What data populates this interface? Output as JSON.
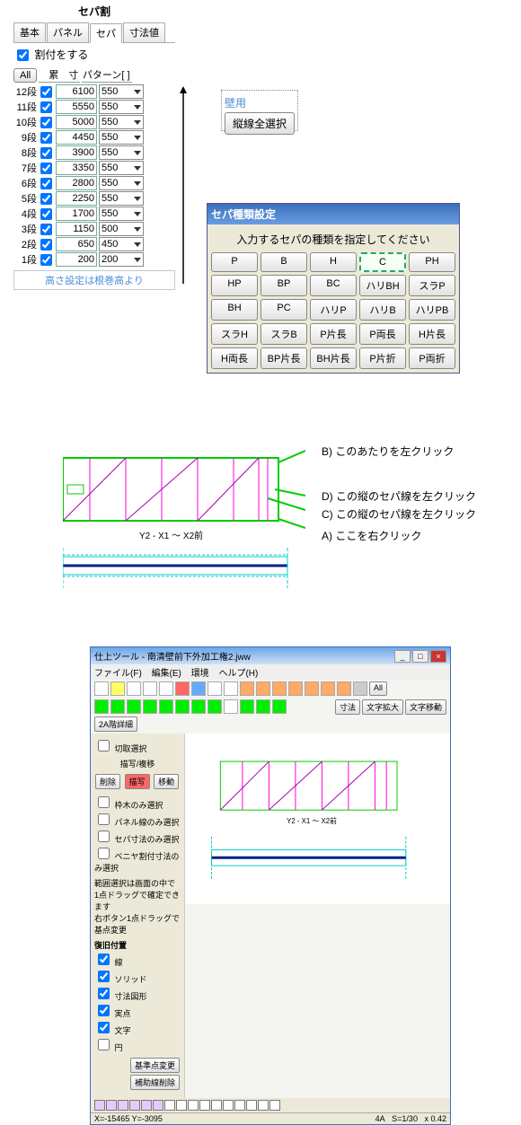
{
  "top_panel": {
    "title": "セパ割",
    "tabs": [
      "基本",
      "パネル",
      "セパ",
      "寸法値"
    ],
    "active_tab": 2,
    "allocate_label": "割付をする",
    "btn_all": "All",
    "head_cum": "累　寸",
    "head_pattern": "パターン[ ]",
    "rows": [
      {
        "lbl": "12段",
        "val": "6100",
        "pat": "550"
      },
      {
        "lbl": "11段",
        "val": "5550",
        "pat": "550"
      },
      {
        "lbl": "10段",
        "val": "5000",
        "pat": "550"
      },
      {
        "lbl": "9段",
        "val": "4450",
        "pat": "550"
      },
      {
        "lbl": "8段",
        "val": "3900",
        "pat": "550"
      },
      {
        "lbl": "7段",
        "val": "3350",
        "pat": "550"
      },
      {
        "lbl": "6段",
        "val": "2800",
        "pat": "550"
      },
      {
        "lbl": "5段",
        "val": "2250",
        "pat": "550"
      },
      {
        "lbl": "4段",
        "val": "1700",
        "pat": "550"
      },
      {
        "lbl": "3段",
        "val": "1150",
        "pat": "500"
      },
      {
        "lbl": "2段",
        "val": "650",
        "pat": "450"
      },
      {
        "lbl": "1段",
        "val": "200",
        "pat": "200"
      }
    ],
    "note": "高さ設定は根巻高より"
  },
  "wall": {
    "label": "壁用",
    "button": "縦線全選択"
  },
  "sepa": {
    "title": "セパ種類設定",
    "instr": "入力するセパの種類を指定してください",
    "buttons": [
      "P",
      "B",
      "H",
      "C",
      "PH",
      "HP",
      "BP",
      "BC",
      "ハリBH",
      "スラP",
      "BH",
      "PC",
      "ハリP",
      "ハリB",
      "ハリPB",
      "スラH",
      "スラB",
      "P片長",
      "P両長",
      "H片長",
      "H両長",
      "BP片長",
      "BH片長",
      "P片折",
      "P両折"
    ],
    "selected_index": 3
  },
  "chart_data": {
    "type": "diagram",
    "label": "Y2 - X1 ～ X2前",
    "annotations": [
      {
        "key": "B",
        "text": "B) このあたりを左クリック"
      },
      {
        "key": "D",
        "text": "D) この縦のセパ線を左クリック"
      },
      {
        "key": "C",
        "text": "C) この縦のセパ線を左クリック"
      },
      {
        "key": "A",
        "text": "A) ここを右クリック"
      }
    ]
  },
  "app": {
    "title": "仕上ツール - 南清壁前下外加工権2.jww",
    "menu": [
      "ファイル(F)",
      "編集(E)",
      "環境",
      "ヘルプ(H)"
    ],
    "right_buttons": [
      "寸法",
      "文字拡大",
      "文字移動",
      "2A階詳細"
    ],
    "check_label": "切取選択",
    "subhead": "描写/複移",
    "act_buttons": [
      "削除",
      "描写",
      "移動"
    ],
    "active_act": 1,
    "opts": [
      "枠木のみ選択",
      "パネル線のみ選択",
      "セパ寸法のみ選択",
      "ベニヤ割付寸法のみ選択"
    ],
    "range_text1": "範囲選択は画面の中で",
    "range_text2": "1点ドラッグで確定できます",
    "range_text3": "右ボタン1点ドラッグで基点変更",
    "cat_title": "復旧付置",
    "cats": [
      {
        "lbl": "線",
        "chk": true
      },
      {
        "lbl": "ソリッド",
        "chk": true
      },
      {
        "lbl": "寸法図形",
        "chk": true
      },
      {
        "lbl": "実点",
        "chk": true
      },
      {
        "lbl": "文字",
        "chk": true
      },
      {
        "lbl": "円",
        "chk": false
      }
    ],
    "side_btns": [
      "基準点変更",
      "補助線削除"
    ],
    "canvas_label": "Y2 - X1 ～ X2前",
    "status_left": "X=-15465  Y=-3095",
    "status_mid": "4A",
    "status_scale": "S=1/30",
    "status_zoom": "x 0.42"
  }
}
